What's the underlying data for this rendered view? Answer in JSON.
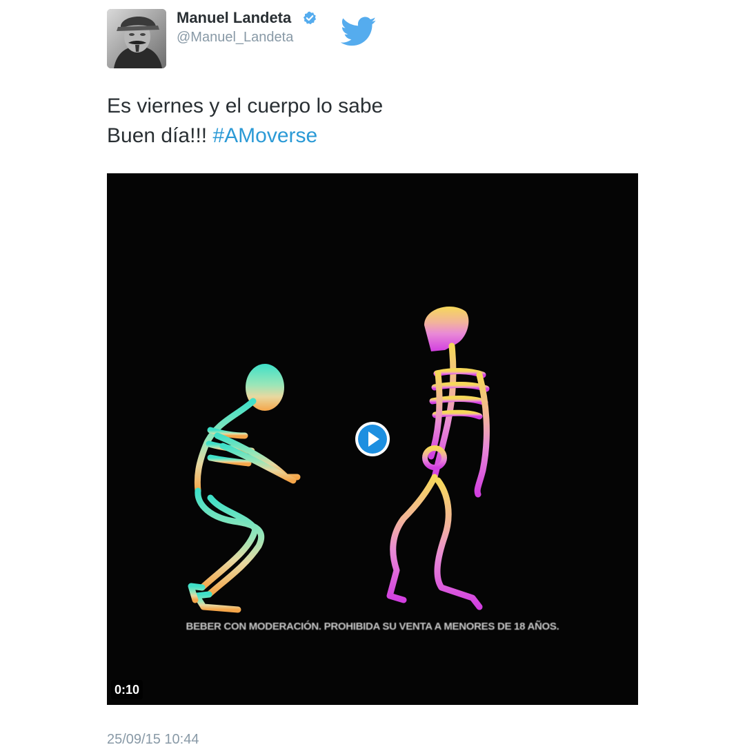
{
  "author": {
    "display_name": "Manuel Landeta",
    "handle": "@Manuel_Landeta",
    "verified": true,
    "avatar_icon": "avatar-photo"
  },
  "brand": {
    "logo_icon": "twitter-bird-icon",
    "color": "#55acee"
  },
  "tweet": {
    "line1": "Es viernes y el cuerpo lo sabe",
    "line2_prefix": "Buen día!!! ",
    "hashtag": "#AMoverse",
    "hashtag_color": "#2b9ad6"
  },
  "media": {
    "type": "video",
    "overlay_text": "BEBER CON MODERACIÓN. PROHIBIDA SU VENTA A MENORES DE 18 AÑOS.",
    "duration": "0:10",
    "play_icon": "play-icon",
    "play_color": "#1d8fe0"
  },
  "timestamp": "25/09/15 10:44"
}
